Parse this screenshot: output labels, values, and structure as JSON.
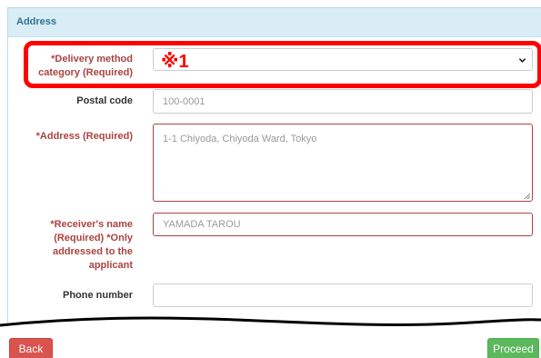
{
  "panel": {
    "title": "Address"
  },
  "form": {
    "delivery": {
      "label": "*Delivery method category (Required)",
      "selected": "※1"
    },
    "postal": {
      "label": "Postal code",
      "placeholder": "100-0001"
    },
    "address": {
      "label": "*Address (Required)",
      "placeholder": "1-1 Chiyoda, Chiyoda Ward, Tokyo"
    },
    "receiver": {
      "label": "*Receiver's name (Required) *Only addressed to the applicant",
      "placeholder": "YAMADA TAROU"
    },
    "phone": {
      "label": "Phone number",
      "placeholder": ""
    }
  },
  "buttons": {
    "back": "Back",
    "proceed": "Proceed"
  },
  "colors": {
    "required_label": "#a94442",
    "annotation": "#ff0000",
    "back_button": "#d9534f",
    "proceed_button": "#5cb85c",
    "panel_heading": "#d9edf7"
  },
  "icons": {
    "select_arrow": "chevron-down-icon",
    "textarea_resize": "resize-grip-icon"
  }
}
